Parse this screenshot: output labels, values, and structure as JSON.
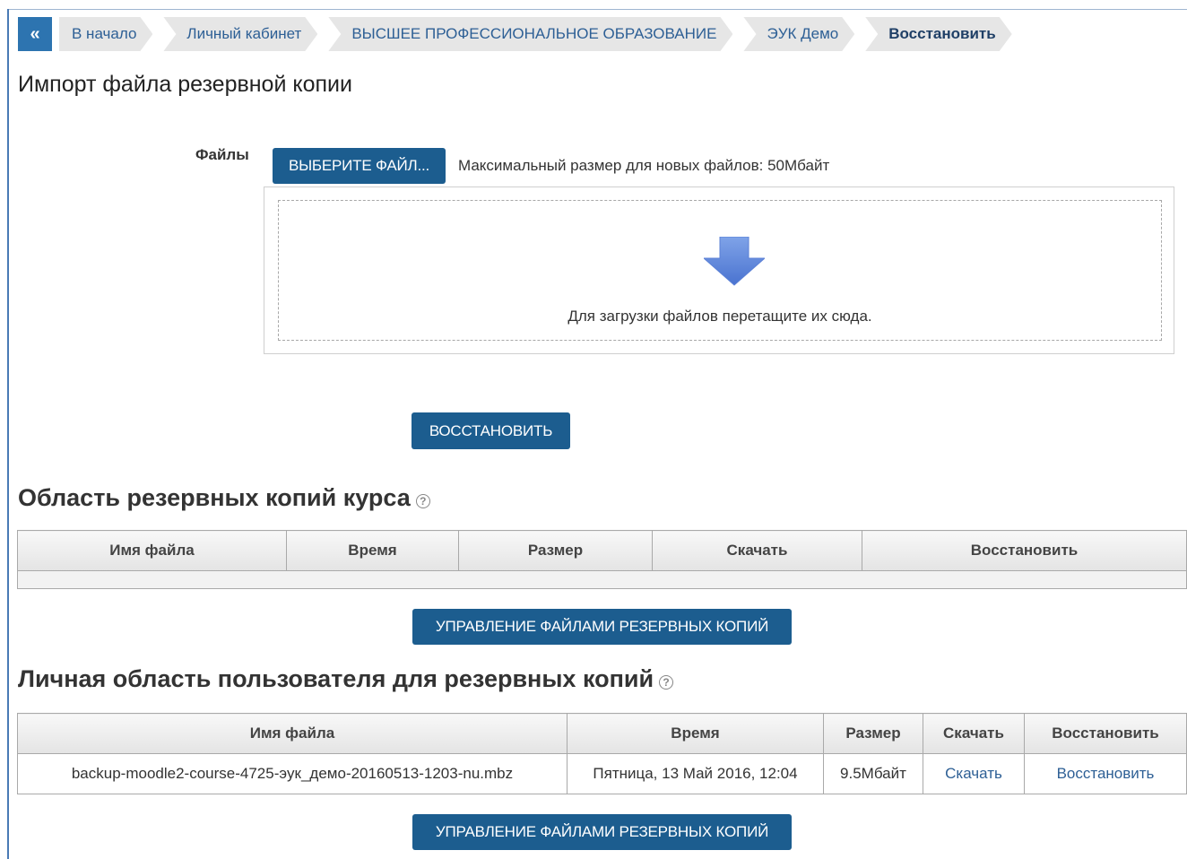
{
  "breadcrumb": {
    "back_symbol": "«",
    "items": [
      "В начало",
      "Личный кабинет",
      "ВЫСШЕЕ ПРОФЕССИОНАЛЬНОЕ ОБРАЗОВАНИЕ",
      "ЭУК Демо",
      "Восстановить"
    ]
  },
  "page_title": "Импорт файла резервной копии",
  "upload": {
    "files_label": "Файлы",
    "choose_button": "ВЫБЕРИТЕ ФАЙЛ...",
    "max_size_text": "Максимальный размер для новых файлов: 50Мбайт",
    "drop_text": "Для загрузки файлов перетащите их сюда.",
    "restore_button": "ВОССТАНОВИТЬ"
  },
  "course_area": {
    "title": "Область резервных копий курса",
    "columns": [
      "Имя файла",
      "Время",
      "Размер",
      "Скачать",
      "Восстановить"
    ],
    "manage_button": "УПРАВЛЕНИЕ ФАЙЛАМИ РЕЗЕРВНЫХ КОПИЙ"
  },
  "user_area": {
    "title": "Личная область пользователя для резервных копий",
    "columns": [
      "Имя файла",
      "Время",
      "Размер",
      "Скачать",
      "Восстановить"
    ],
    "rows": [
      {
        "filename": "backup-moodle2-course-4725-эук_демо-20160513-1203-nu.mbz",
        "time": "Пятница, 13 Май 2016, 12:04",
        "size": "9.5Мбайт",
        "download": "Скачать",
        "restore": "Восстановить"
      }
    ],
    "manage_button": "УПРАВЛЕНИЕ ФАЙЛАМИ РЕЗЕРВНЫХ КОПИЙ"
  },
  "colors": {
    "primary_button": "#1c5d8f",
    "link": "#2d5f95",
    "breadcrumb_back": "#2d74b0"
  }
}
